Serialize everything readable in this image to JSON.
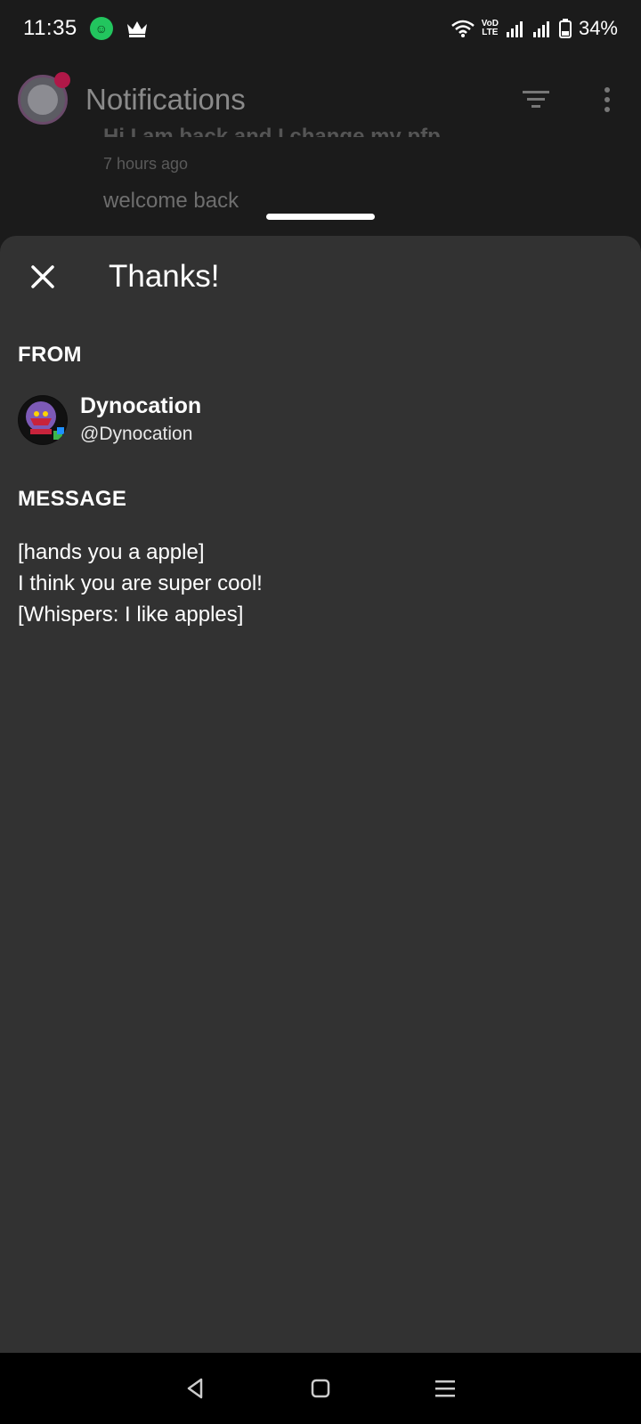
{
  "status_bar": {
    "time": "11:35",
    "volte_top": "VoD",
    "volte_bottom": "LTE",
    "battery": "34%"
  },
  "app_bar": {
    "title": "Notifications"
  },
  "background_list": {
    "cut_text": "Hi I am back and I change my pfp",
    "time_ago": "7 hours ago",
    "reply": "welcome back"
  },
  "sheet": {
    "title": "Thanks!",
    "from_label": "FROM",
    "sender": {
      "name": "Dynocation",
      "handle": "@Dynocation"
    },
    "message_label": "MESSAGE",
    "message_lines": [
      "[hands you a apple]",
      "I think you are super cool!",
      "[Whispers: I like apples]"
    ]
  },
  "colors": {
    "background": "#1b1b1b",
    "sheet": "#323232",
    "notification_dot": "#b01848",
    "app_status_dot": "#22c55e"
  }
}
